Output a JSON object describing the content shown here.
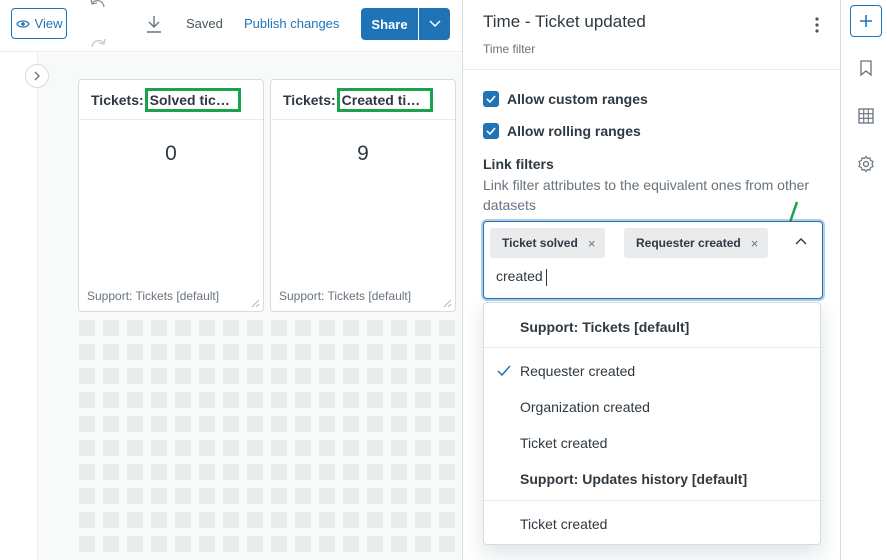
{
  "toolbar": {
    "view_label": "View",
    "saved_label": "Saved",
    "publish_label": "Publish changes",
    "share_label": "Share"
  },
  "widgets": [
    {
      "prefix": "Tickets: ",
      "highlight": "Solved tickets",
      "value": "0",
      "footer": "Support: Tickets [default]"
    },
    {
      "prefix": "Tickets: ",
      "highlight": "Created tickets",
      "value": "9",
      "footer": "Support: Tickets [default]"
    }
  ],
  "panel": {
    "title": "Time - Ticket updated",
    "subtitle": "Time filter",
    "checkbox_custom": "Allow custom ranges",
    "checkbox_rolling": "Allow rolling ranges",
    "link_title": "Link filters",
    "link_hint": "Link filter attributes to the equivalent ones from other datasets",
    "tags": [
      "Ticket solved",
      "Requester created"
    ],
    "tag_remove": "×",
    "search_value": "created",
    "dropdown": {
      "group1": "Support: Tickets [default]",
      "group1_options": [
        "Requester created",
        "Organization created",
        "Ticket created"
      ],
      "group2": "Support: Updates history [default]",
      "group2_options": [
        "Ticket created"
      ]
    }
  },
  "colors": {
    "brand_blue": "#1f73b7",
    "highlight_green": "#1aa34a",
    "annotation_arrow": "#1aa34a"
  },
  "icons": [
    "eye-icon",
    "undo-icon",
    "redo-icon",
    "download-icon",
    "chevron-down-icon",
    "chevron-right-icon",
    "resize-handle-icon",
    "kebab-menu-icon",
    "checkmark-icon",
    "close-icon",
    "chevron-up-icon",
    "plus-icon",
    "bookmark-icon",
    "table-icon",
    "gear-icon",
    "annotation-arrow-icon"
  ]
}
